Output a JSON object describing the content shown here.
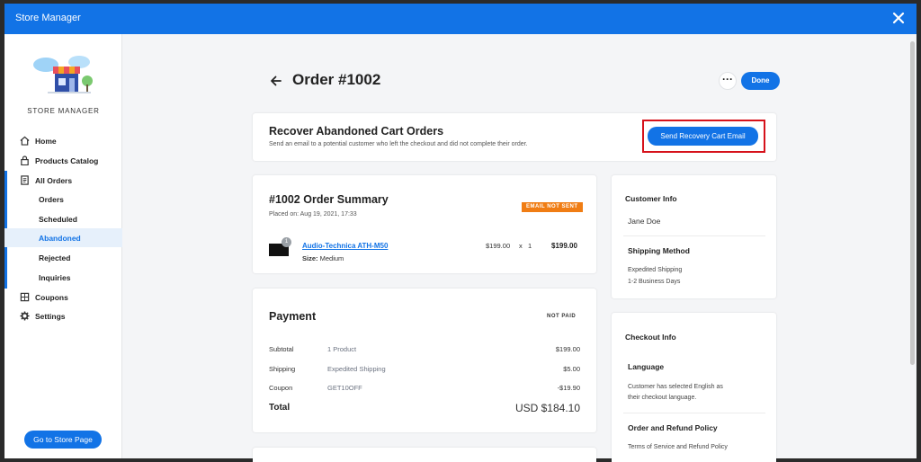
{
  "window": {
    "title": "Store Manager"
  },
  "sidebar": {
    "brand": "STORE MANAGER",
    "nav": [
      {
        "label": "Home",
        "icon": "home-icon"
      },
      {
        "label": "Products Catalog",
        "icon": "lock-icon"
      },
      {
        "label": "All Orders",
        "icon": "document-icon"
      }
    ],
    "orders_sub": [
      {
        "label": "Orders"
      },
      {
        "label": "Scheduled"
      },
      {
        "label": "Abandoned",
        "active": true
      },
      {
        "label": "Rejected"
      },
      {
        "label": "Inquiries"
      }
    ],
    "nav_bottom": [
      {
        "label": "Coupons",
        "icon": "coupon-icon"
      },
      {
        "label": "Settings",
        "icon": "gear-icon"
      }
    ],
    "store_button": "Go to Store Page"
  },
  "header": {
    "order_title": "Order #1002",
    "more_label": "···",
    "done_label": "Done"
  },
  "recover": {
    "title": "Recover Abandoned Cart Orders",
    "description": "Send an email to a potential customer who left the checkout and did not complete their order.",
    "button": "Send Recovery Cart Email"
  },
  "summary": {
    "title": "#1002 Order Summary",
    "placed": "Placed on: Aug 19, 2021, 17:33",
    "badge": "EMAIL NOT SENT",
    "product": {
      "name": "Audio-Technica ATH-M50",
      "size_label": "Size:",
      "size_value": "Medium",
      "unit_price": "$199.00",
      "x": "x",
      "qty": "1",
      "total": "$199.00",
      "count_badge": "1"
    }
  },
  "payment": {
    "title": "Payment",
    "status": "NOT PAID",
    "rows": [
      {
        "label": "Subtotal",
        "detail": "1 Product",
        "amount": "$199.00"
      },
      {
        "label": "Shipping",
        "detail": "Expedited Shipping",
        "amount": "$5.00"
      },
      {
        "label": "Coupon",
        "detail": "GET10OFF",
        "amount": "-$19.90"
      }
    ],
    "total_label": "Total",
    "total_value": "USD $184.10"
  },
  "customer": {
    "title": "Customer Info",
    "name": "Jane Doe",
    "shipping_title": "Shipping Method",
    "shipping_line1": "Expedited Shipping",
    "shipping_line2": "1-2 Business Days"
  },
  "checkout": {
    "title": "Checkout Info",
    "language_title": "Language",
    "language_line1": "Customer has selected English as",
    "language_line2": "their checkout language.",
    "policy_title": "Order and Refund Policy",
    "policy_line1": "Terms of Service and Refund Policy"
  },
  "colors": {
    "accent": "#1273e6",
    "badge": "#f07d14",
    "highlight": "#d6121b"
  }
}
